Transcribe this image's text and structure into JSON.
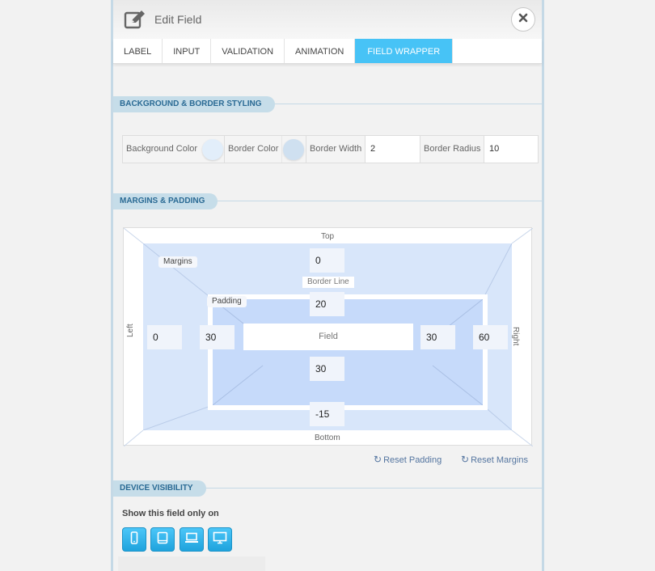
{
  "header": {
    "title": "Edit Field"
  },
  "tabs": [
    {
      "label": "LABEL"
    },
    {
      "label": "INPUT"
    },
    {
      "label": "VALIDATION"
    },
    {
      "label": "ANIMATION"
    },
    {
      "label": "FIELD WRAPPER",
      "active": true
    }
  ],
  "sections": {
    "background": "BACKGROUND & BORDER STYLING",
    "margins": "MARGINS & PADDING",
    "visibility": "DEVICE VISIBILITY"
  },
  "styling": {
    "bg_color_label": "Background Color",
    "bg_color": "#e2eefa",
    "border_color_label": "Border Color",
    "border_color": "#cfe0f0",
    "border_width_label": "Border Width",
    "border_width": "2",
    "border_radius_label": "Border Radius",
    "border_radius": "10"
  },
  "box_model": {
    "top": "Top",
    "bottom": "Bottom",
    "left": "Left",
    "right": "Right",
    "margins_tag": "Margins",
    "padding_tag": "Padding",
    "border_line": "Border Line",
    "field": "Field",
    "margin_top": "0",
    "margin_bottom": "-15",
    "margin_left": "0",
    "margin_right": "60",
    "padding_top": "20",
    "padding_bottom": "30",
    "padding_left": "30",
    "padding_right": "30"
  },
  "actions": {
    "reset_padding": "Reset Padding",
    "reset_margins": "Reset Margins"
  },
  "visibility": {
    "label": "Show this field only on",
    "devices": [
      "mobile-icon",
      "tablet-icon",
      "laptop-icon",
      "desktop-icon"
    ]
  },
  "colors": {
    "accent": "#47c3f6",
    "section_pill": "#c6dde9",
    "margin_area": "#d8e6fa",
    "padding_area": "#c6dafa"
  }
}
